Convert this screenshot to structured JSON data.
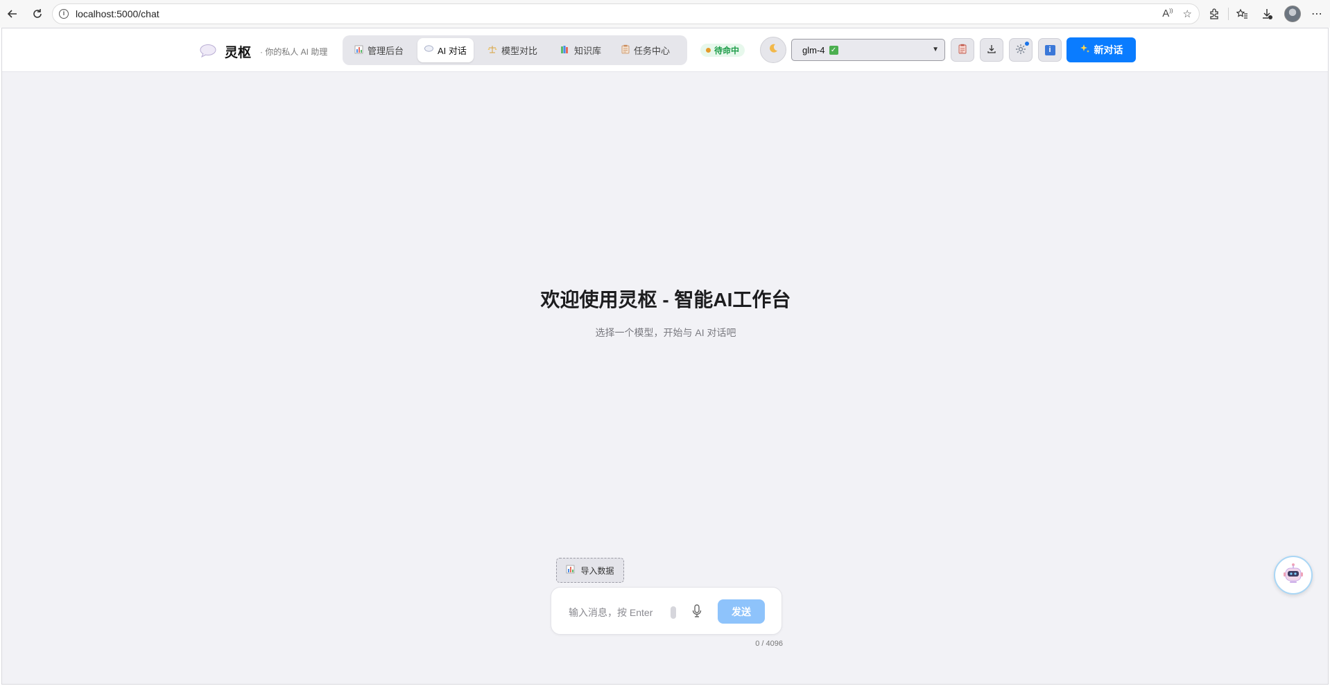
{
  "browser": {
    "url": "localhost:5000/chat"
  },
  "header": {
    "brand_title": "灵枢",
    "brand_subtitle": "· 你的私人 AI 助理",
    "tabs": [
      {
        "label": "管理后台",
        "icon": "bar-chart-icon"
      },
      {
        "label": "AI 对话",
        "icon": "chat-bubble-icon",
        "active": true
      },
      {
        "label": "模型对比",
        "icon": "scale-icon"
      },
      {
        "label": "知识库",
        "icon": "books-icon"
      },
      {
        "label": "任务中心",
        "icon": "clipboard-icon"
      }
    ],
    "status": "待命中",
    "model": {
      "selected": "glm-4"
    },
    "new_chat_label": "新对话"
  },
  "main": {
    "welcome_title": "欢迎使用灵枢 - 智能AI工作台",
    "welcome_subtitle": "选择一个模型，开始与 AI 对话吧"
  },
  "composer": {
    "import_label": "导入数据",
    "placeholder": "输入消息，按 Enter",
    "send_label": "发送",
    "counter": "0 / 4096"
  },
  "colors": {
    "accent": "#0a7cff",
    "send_disabled": "#8ec3fb",
    "status_green": "#1f9d4a",
    "background": "#f2f2f6"
  }
}
